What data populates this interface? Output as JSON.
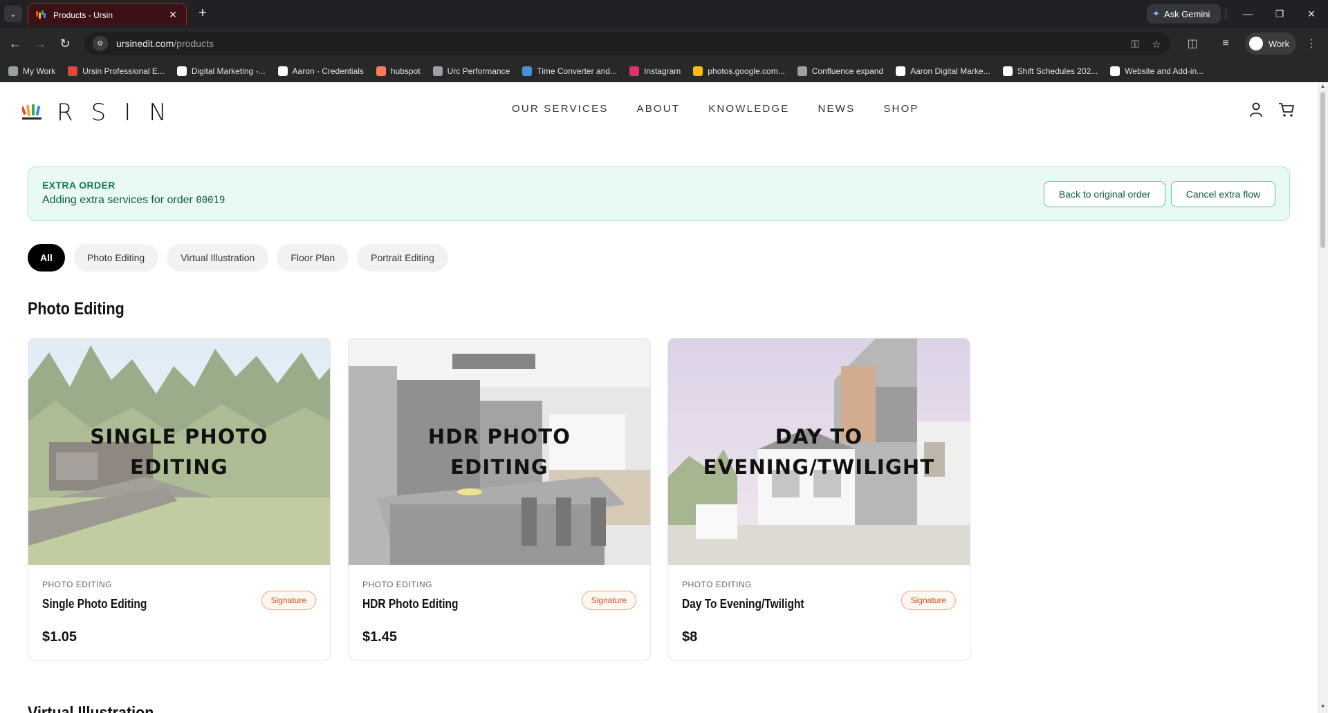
{
  "browser": {
    "tab_title": "Products - Ursin",
    "gemini_label": "Ask Gemini",
    "url_host": "ursinedit.com",
    "url_path": "/products",
    "profile_label": "Work",
    "bookmarks": [
      {
        "label": "My Work",
        "color": "#9aa0a6"
      },
      {
        "label": "Ursin Professional E...",
        "color": "#e8453c"
      },
      {
        "label": "Digital Marketing -...",
        "color": "#ffffff"
      },
      {
        "label": "Aaron - Credentials",
        "color": "#ffffff"
      },
      {
        "label": "hubspot",
        "color": "#ff7a59"
      },
      {
        "label": "Urc Performance",
        "color": "#9aa0a6"
      },
      {
        "label": "Time Converter and...",
        "color": "#4a90d9"
      },
      {
        "label": "Instagram",
        "color": "#e1306c"
      },
      {
        "label": "photos.google.com...",
        "color": "#fbbc04"
      },
      {
        "label": "Confluence expand",
        "color": "#9aa0a6"
      },
      {
        "label": "Aaron Digital Marke...",
        "color": "#ffffff"
      },
      {
        "label": "Shift Schedules 202...",
        "color": "#ffffff"
      },
      {
        "label": "Website and Add-in...",
        "color": "#ffffff"
      }
    ]
  },
  "site": {
    "logo_word": "RSIN",
    "nav": [
      "OUR SERVICES",
      "ABOUT",
      "KNOWLEDGE",
      "NEWS",
      "SHOP"
    ]
  },
  "extra_order": {
    "tag": "EXTRA ORDER",
    "text": "Adding extra services for order",
    "order_number": "00019",
    "back_button": "Back to original order",
    "cancel_button": "Cancel extra flow"
  },
  "filters": [
    "All",
    "Photo Editing",
    "Virtual Illustration",
    "Floor Plan",
    "Portrait Editing"
  ],
  "active_filter": "All",
  "section": {
    "title": "Photo Editing",
    "next_title": "Virtual Illustration"
  },
  "products": [
    {
      "image_title": "SINGLE PHOTO EDITING",
      "category": "PHOTO EDITING",
      "name": "Single Photo Editing",
      "badge": "Signature",
      "price": "$1.05"
    },
    {
      "image_title": "HDR PHOTO EDITING",
      "category": "PHOTO EDITING",
      "name": "HDR Photo Editing",
      "badge": "Signature",
      "price": "$1.45"
    },
    {
      "image_title": "DAY TO EVENING/TWILIGHT",
      "category": "PHOTO EDITING",
      "name": "Day To Evening/Twilight",
      "badge": "Signature",
      "price": "$8"
    }
  ],
  "colors": {
    "brand_green": "#13795b",
    "banner_bg": "#e9faf3",
    "badge_orange": "#c8501b"
  }
}
